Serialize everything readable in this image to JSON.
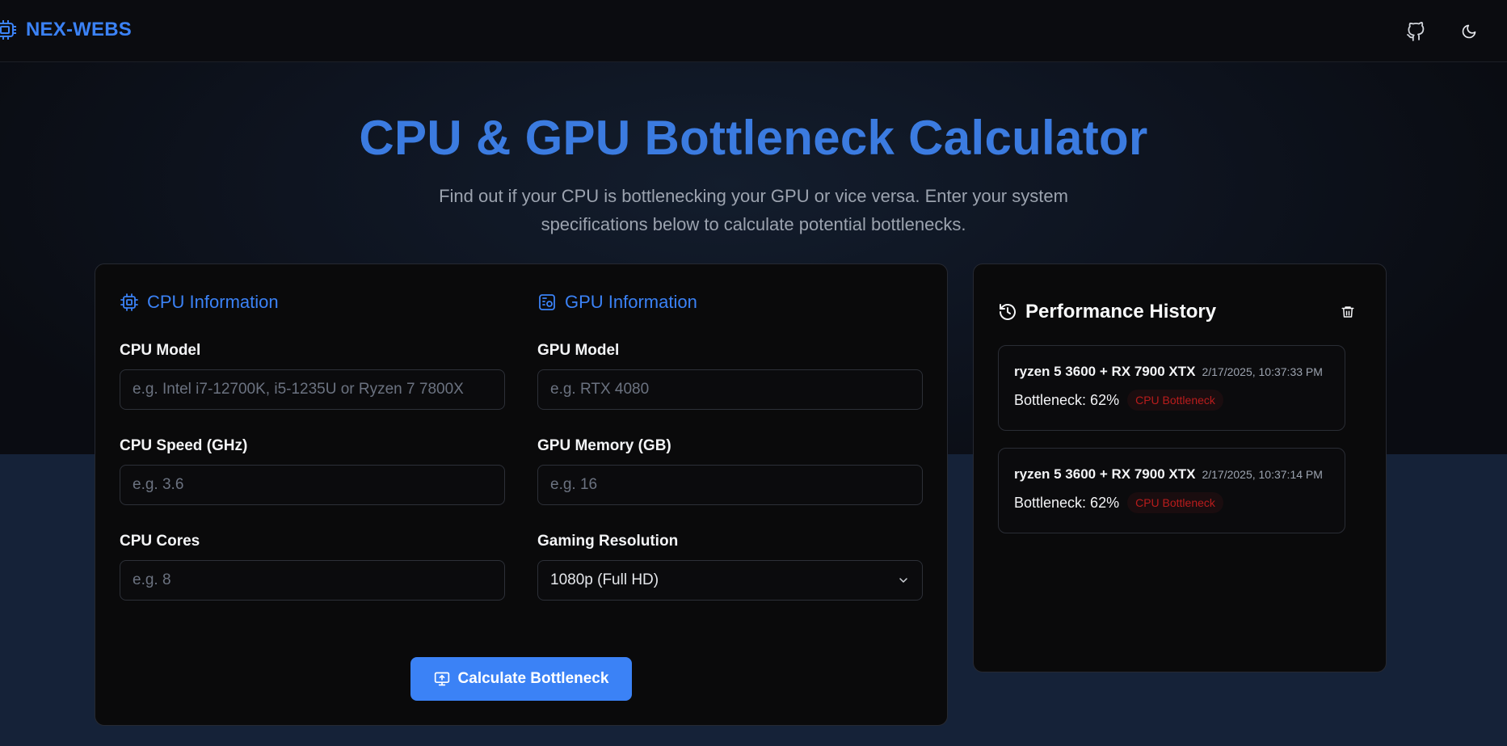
{
  "nav": {
    "brand": "NEX-WEBS",
    "github_icon": "github-icon",
    "theme_icon": "moon-icon"
  },
  "hero": {
    "title": "CPU & GPU Bottleneck Calculator",
    "subtitle": "Find out if your CPU is bottlenecking your GPU or vice versa. Enter your system specifications below to calculate potential bottlenecks."
  },
  "cpu": {
    "section_title": "CPU Information",
    "model_label": "CPU Model",
    "model_placeholder": "e.g. Intel i7-12700K, i5-1235U or Ryzen 7 7800X",
    "speed_label": "CPU Speed (GHz)",
    "speed_placeholder": "e.g. 3.6",
    "cores_label": "CPU Cores",
    "cores_placeholder": "e.g. 8"
  },
  "gpu": {
    "section_title": "GPU Information",
    "model_label": "GPU Model",
    "model_placeholder": "e.g. RTX 4080",
    "memory_label": "GPU Memory (GB)",
    "memory_placeholder": "e.g. 16",
    "resolution_label": "Gaming Resolution",
    "resolution_value": "1080p (Full HD)"
  },
  "actions": {
    "calculate_label": "Calculate Bottleneck"
  },
  "history": {
    "title": "Performance History",
    "items": [
      {
        "combo": "ryzen 5 3600 + RX 7900 XTX",
        "time": "2/17/2025, 10:37:33 PM",
        "bottleneck": "Bottleneck: 62%",
        "badge": "CPU Bottleneck"
      },
      {
        "combo": "ryzen 5 3600 + RX 7900 XTX",
        "time": "2/17/2025, 10:37:14 PM",
        "bottleneck": "Bottleneck: 62%",
        "badge": "CPU Bottleneck"
      }
    ]
  },
  "colors": {
    "accent": "#3b82f6",
    "badge_text": "#b91c1c"
  }
}
